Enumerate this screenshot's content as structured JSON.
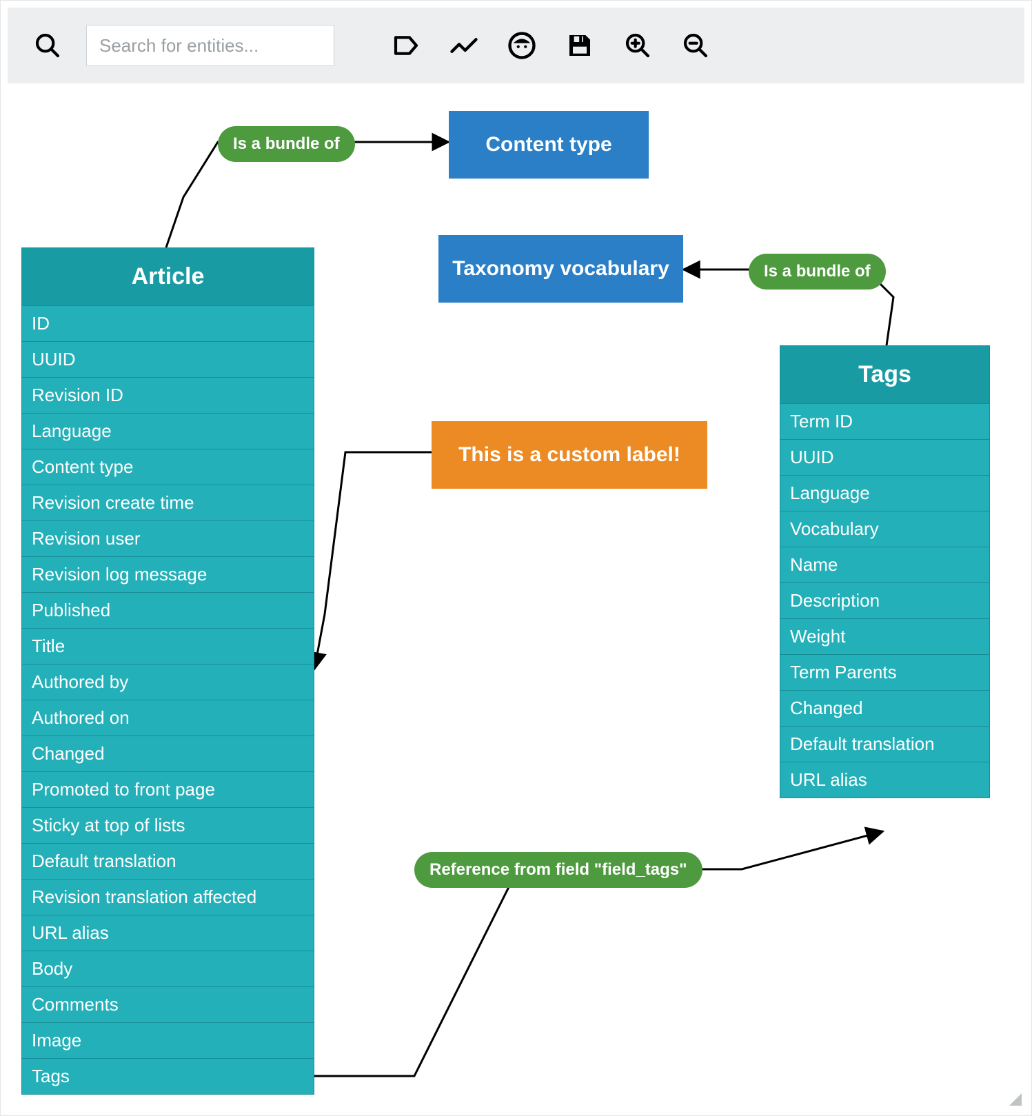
{
  "toolbar": {
    "search_placeholder": "Search for entities..."
  },
  "boxes": {
    "content_type": "Content type",
    "taxonomy_vocab": "Taxonomy vocabulary",
    "custom_label": "This is a custom label!"
  },
  "labels": {
    "bundle_of_1": "Is a bundle of",
    "bundle_of_2": "Is a bundle of",
    "reference_tags": "Reference from field \"field_tags\""
  },
  "entities": {
    "article": {
      "title": "Article",
      "fields": [
        "ID",
        "UUID",
        "Revision ID",
        "Language",
        "Content type",
        "Revision create time",
        "Revision user",
        "Revision log message",
        "Published",
        "Title",
        "Authored by",
        "Authored on",
        "Changed",
        "Promoted to front page",
        "Sticky at top of lists",
        "Default translation",
        "Revision translation affected",
        "URL alias",
        "Body",
        "Comments",
        "Image",
        "Tags"
      ]
    },
    "tags": {
      "title": "Tags",
      "fields": [
        "Term ID",
        "UUID",
        "Language",
        "Vocabulary",
        "Name",
        "Description",
        "Weight",
        "Term Parents",
        "Changed",
        "Default translation",
        "URL alias"
      ]
    }
  }
}
